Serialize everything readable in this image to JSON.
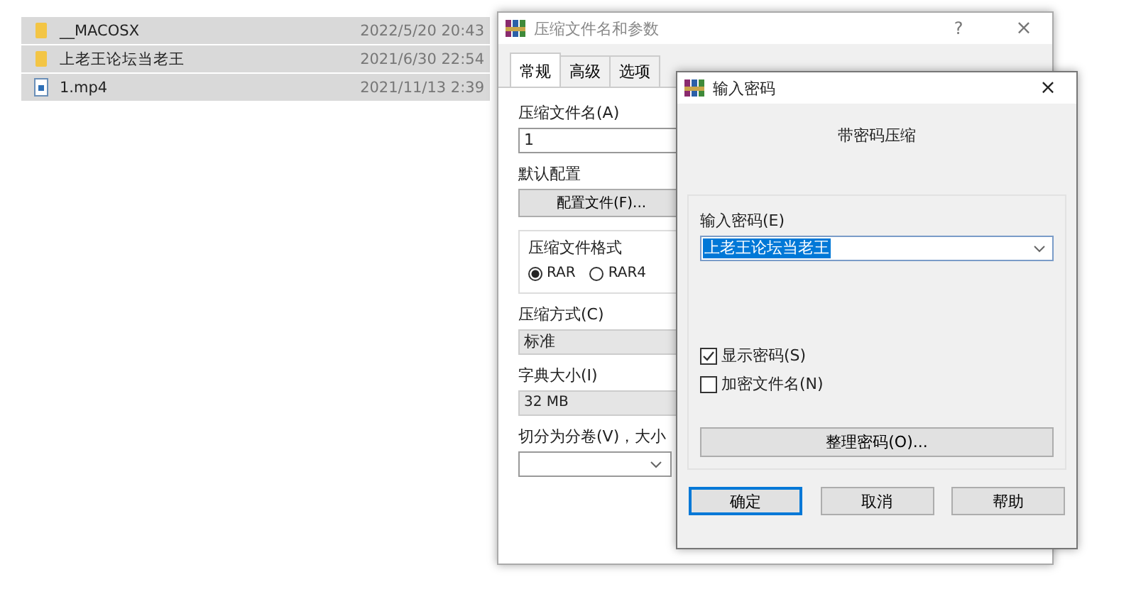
{
  "files": [
    {
      "kind": "folder",
      "name": "__MACOSX",
      "modified": "2022/5/20 20:43",
      "selected": true
    },
    {
      "kind": "folder",
      "name": "上老王论坛当老王",
      "modified": "2021/6/30 22:54",
      "selected": true
    },
    {
      "kind": "file",
      "name": "1.mp4",
      "modified": "2021/11/13 2:39",
      "selected": true
    }
  ],
  "archive_dialog": {
    "title": "压缩文件名和参数",
    "help": "?",
    "close": "×",
    "tabs": [
      {
        "label": "常规",
        "selected": true
      },
      {
        "label": "高级",
        "selected": false
      },
      {
        "label": "选项",
        "selected": false
      }
    ],
    "archive_name_label": "压缩文件名(A)",
    "archive_name": "1",
    "profile_label": "默认配置",
    "profile_button": "配置文件(F)...",
    "format_group": "压缩文件格式",
    "formats": [
      {
        "label": "RAR",
        "selected": true
      },
      {
        "label": "RAR4",
        "selected": false
      }
    ],
    "method_label": "压缩方式(C)",
    "method": "标准",
    "dictionary_label": "字典大小(I)",
    "dictionary": "32 MB",
    "split_label": "切分为分卷(V)，大小"
  },
  "password_dialog": {
    "title": "输入密码",
    "close": "×",
    "heading": "带密码压缩",
    "password_label": "输入密码(E)",
    "password": "上老王论坛当老王",
    "password_highlighted": true,
    "options": [
      {
        "label": "显示密码(S)",
        "checked": true
      },
      {
        "label": "加密文件名(N)",
        "checked": false
      }
    ],
    "organize_button": "整理密码(O)...",
    "buttons": [
      {
        "label": "确定",
        "selected": true
      },
      {
        "label": "取消",
        "selected": false
      },
      {
        "label": "帮助",
        "selected": false
      }
    ]
  }
}
